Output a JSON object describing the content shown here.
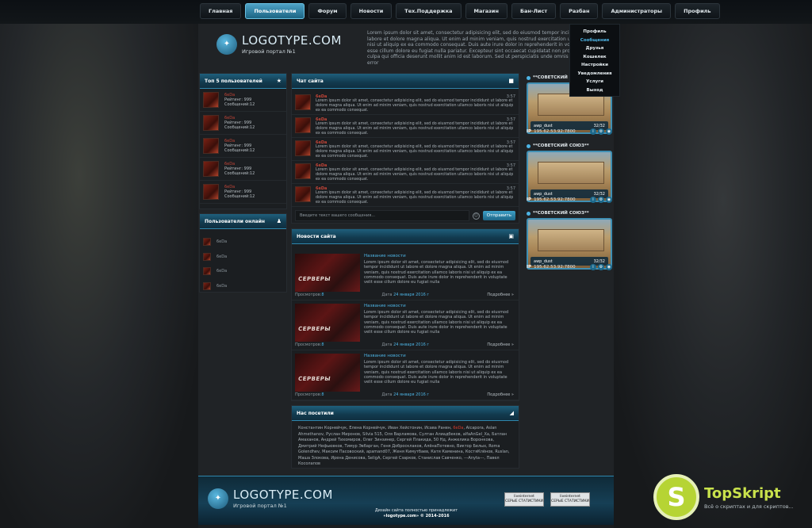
{
  "nav": {
    "items": [
      "Главная",
      "Пользователи",
      "Форум",
      "Новости",
      "Тех.Поддержка",
      "Магазин",
      "Бан-Лист",
      "Разбан",
      "Администраторы",
      "Профиль"
    ],
    "active_index": 1
  },
  "profile_menu": {
    "items": [
      "Профиль",
      "Сообщения",
      "Друзья",
      "Кошелек",
      "Настройки",
      "Уведомления",
      "Услуги",
      "Выход"
    ],
    "highlight_index": 1
  },
  "brand": {
    "name": "LOGOTYPE.COM",
    "tagline": "Игровой портал №1"
  },
  "header_text": "Lorem ipsum dolor sit amet, consectetur adipisicing elit, sed do eiusmod tempor incididunt ut labore et dolore magna aliqua. Ut enim ad minim veniam, quis nostrud exercitation ullamco laboris nisi ut aliquip ex ea commodo consequat. Duis aute irure dolor in reprehenderit in voluptate velit esse cillum dolore eu fugiat nulla pariatur. Excepteur sint occaecat cupidatat non proident, sunt in culpa qui officia deserunt mollit anim id est laborum. Sed ut perspiciatis unde omnis iste natus error",
  "top_users": {
    "title": "Топ 5 пользователей",
    "users": [
      {
        "name": "6eDa",
        "rating": "Рейтинг: 999",
        "messages": "Сообщений:12"
      },
      {
        "name": "6eDa",
        "rating": "Рейтинг: 999",
        "messages": "Сообщений:12"
      },
      {
        "name": "6eDa",
        "rating": "Рейтинг: 999",
        "messages": "Сообщений:12"
      },
      {
        "name": "6eDa",
        "rating": "Рейтинг: 999",
        "messages": "Сообщений:12"
      },
      {
        "name": "6eDa",
        "rating": "Рейтинг: 999",
        "messages": "Сообщений:12"
      }
    ]
  },
  "online_users": {
    "title": "Пользователи онлайн",
    "users": [
      "6eDa",
      "6eDa",
      "6eDa",
      "6eDa"
    ]
  },
  "chat": {
    "title": "Чат сайта",
    "messages": [
      {
        "name": "6eDa",
        "time": "3:57",
        "text": "Lorem ipsum dolor sit amet, consectetur adipisicing elit, sed do eiusmod tempor incididunt ut labore et dolore magna aliqua. Ut enim ad minim veniam, quis nostrud exercitation ullamco laboris nisi ut aliquip ex ea commodo consequat."
      },
      {
        "name": "6eDa",
        "time": "3:57",
        "text": "Lorem ipsum dolor sit amet, consectetur adipisicing elit, sed do eiusmod tempor incididunt ut labore et dolore magna aliqua. Ut enim ad minim veniam, quis nostrud exercitation ullamco laboris nisi ut aliquip ex ea commodo consequat."
      },
      {
        "name": "6eDa",
        "time": "3:57",
        "text": "Lorem ipsum dolor sit amet, consectetur adipisicing elit, sed do eiusmod tempor incididunt ut labore et dolore magna aliqua. Ut enim ad minim veniam, quis nostrud exercitation ullamco laboris nisi ut aliquip ex ea commodo consequat."
      },
      {
        "name": "6eDa",
        "time": "3:57",
        "text": "Lorem ipsum dolor sit amet, consectetur adipisicing elit, sed do eiusmod tempor incididunt ut labore et dolore magna aliqua. Ut enim ad minim veniam, quis nostrud exercitation ullamco laboris nisi ut aliquip ex ea commodo consequat."
      },
      {
        "name": "6eDa",
        "time": "3:57",
        "text": "Lorem ipsum dolor sit amet, consectetur adipisicing elit, sed do eiusmod tempor incididunt ut labore et dolore magna aliqua. Ut enim ad minim veniam, quis nostrud exercitation ullamco laboris nisi ut aliquip ex ea commodo consequat."
      }
    ],
    "input_placeholder": "Введите текст вашего сообщения...",
    "send_label": "Отправить"
  },
  "news": {
    "title": "Новости сайта",
    "items": [
      {
        "title": "Название новости",
        "image_caption": "СЕРВЕРЫ",
        "text": "Lorem ipsum dolor sit amet, consectetur adipisicing elit, sed do eiusmod tempor incididunt ut labore et dolore magna aliqua. Ut enim ad minim veniam, quis nostrud exercitation ullamco laboris nisi ut aliquip ex ea commodo consequat. Duis aute irure dolor in reprehenderit in voluptate velit esse cillum dolore eu fugiat nulla",
        "views_label": "Просмотров:",
        "views": "8",
        "date_label": "Дата",
        "date": "24 января 2016 г",
        "more": "Подробнее »"
      },
      {
        "title": "Название новости",
        "image_caption": "СЕРВЕРЫ",
        "text": "Lorem ipsum dolor sit amet, consectetur adipisicing elit, sed do eiusmod tempor incididunt ut labore et dolore magna aliqua. Ut enim ad minim veniam, quis nostrud exercitation ullamco laboris nisi ut aliquip ex ea commodo consequat. Duis aute irure dolor in reprehenderit in voluptate velit esse cillum dolore eu fugiat nulla",
        "views_label": "Просмотров:",
        "views": "8",
        "date_label": "Дата",
        "date": "24 января 2016 г",
        "more": "Подробнее »"
      },
      {
        "title": "Название новости",
        "image_caption": "СЕРВЕРЫ",
        "text": "Lorem ipsum dolor sit amet, consectetur adipisicing elit, sed do eiusmod tempor incididunt ut labore et dolore magna aliqua. Ut enim ad minim veniam, quis nostrud exercitation ullamco laboris nisi ut aliquip ex ea commodo consequat. Duis aute irure dolor in reprehenderit in voluptate velit esse cillum dolore eu fugiat nulla",
        "views_label": "Просмотров:",
        "views": "8",
        "date_label": "Дата",
        "date": "24 января 2016 г",
        "more": "Подробнее »"
      }
    ]
  },
  "visitors": {
    "title": "Нас посетили",
    "before_red": "Константин Корнейчук, Елена Корнейчук, Иван Хейстонин, Исава Ранен, ",
    "red": "6eDa",
    "after_red": ", Aicapora, Aslan Ahmethanov, Руслан Миронов, Silvia 515, Оля Варламова, Султан Алиадбеков, alfaAnGel_Xa, Батлан Амаханов, Андрей Тихомиров, Олег Зинзинер, Сергей Плакида, 50 Нд, Анжелика Воронкова, Дмитрий Нефьювков, Тимур Эвбарган, Геня Добросклаков, АлёнаПотевно, Виктор Белых, Roma Golendhev, Максим Пасовоский, apamand07, Женя Кимутбаев, Катя Каменина, КостяКлёнов, Ruslan, Маша Злокова, Ирена Денисова, SeligA, Сергей Сзарков, Станислав Савченко, ---Anyta---, Павел Косолапов"
  },
  "servers": [
    {
      "name": "**СОВЕТСКИЙ СОЮЗ**",
      "map": "awp_dust",
      "players": "32/32",
      "ip_label": "IP",
      "ip": "195.62.53.92:7800"
    },
    {
      "name": "**СОВЕТСКИЙ СОЮЗ**",
      "map": "awp_dust",
      "players": "32/32",
      "ip_label": "IP",
      "ip": "195.62.53.92:7800"
    },
    {
      "name": "**СОВЕТСКИЙ СОЮЗ**",
      "map": "awp_dust",
      "players": "32/32",
      "ip_label": "IP",
      "ip": "195.62.53.92:7800"
    }
  ],
  "footer": {
    "copy_line1": "Дизайн сайта полностью принадлежит",
    "copy_line2": "«logotype.com» © 2014-2016",
    "counters": [
      {
        "line1": "liveinternet",
        "line2": "СЕРЫЕ СТАТИСТИКИ"
      },
      {
        "line1": "liveinternet",
        "line2": "СЕРЫЕ СТАТИСТИКИ"
      }
    ]
  },
  "watermark": {
    "name": "TopSkript",
    "tagline": "Всё о скриптах и для скриптов...",
    "letter": "S"
  },
  "colors": {
    "accent": "#4db4e4",
    "header_blue": "#1f5f7c",
    "username_red": "#c24437",
    "watermark_green": "#b6d434"
  }
}
